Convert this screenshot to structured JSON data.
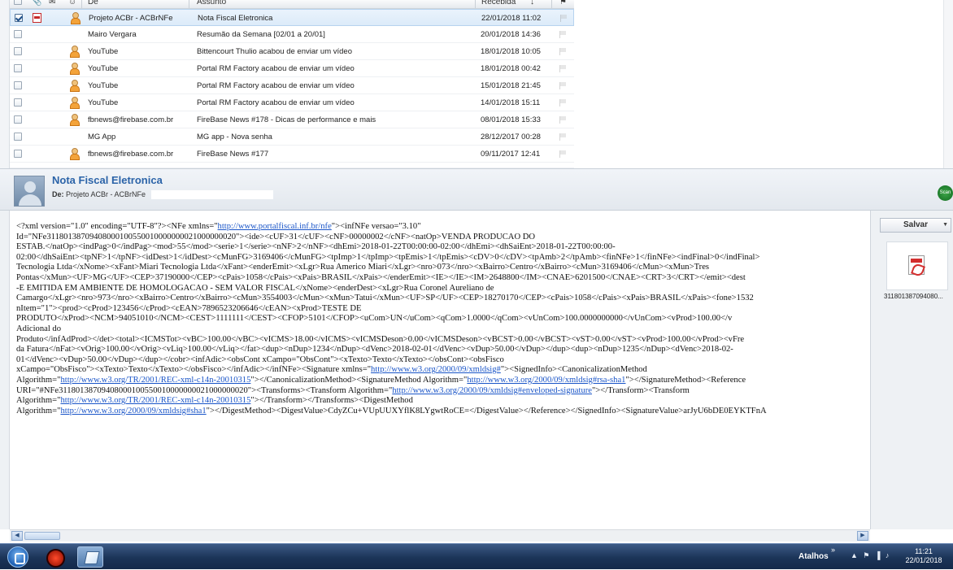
{
  "list": {
    "headers": {
      "de": "De",
      "assunto": "Assunto",
      "recebida": "Recebida"
    },
    "rows": [
      {
        "from": "Projeto ACBr - ACBrNFe",
        "subject": "Nota Fiscal Eletronica",
        "date": "22/01/2018 11:02",
        "selected": true,
        "checked": true,
        "attachment": true,
        "person": true
      },
      {
        "from": "Mairo Vergara",
        "subject": "Resumão da Semana [02/01 a 20/01]",
        "date": "20/01/2018 14:36",
        "selected": false,
        "checked": false,
        "attachment": false,
        "person": false
      },
      {
        "from": "YouTube",
        "subject": "Bittencourt Thulio acabou de enviar um vídeo",
        "date": "18/01/2018 10:05",
        "selected": false,
        "checked": false,
        "attachment": false,
        "person": true
      },
      {
        "from": "YouTube",
        "subject": "Portal RM Factory acabou de enviar um vídeo",
        "date": "18/01/2018 00:42",
        "selected": false,
        "checked": false,
        "attachment": false,
        "person": true
      },
      {
        "from": "YouTube",
        "subject": "Portal RM Factory acabou de enviar um vídeo",
        "date": "15/01/2018 21:45",
        "selected": false,
        "checked": false,
        "attachment": false,
        "person": true
      },
      {
        "from": "YouTube",
        "subject": "Portal RM Factory acabou de enviar um vídeo",
        "date": "14/01/2018 15:11",
        "selected": false,
        "checked": false,
        "attachment": false,
        "person": true
      },
      {
        "from": "fbnews@firebase.com.br",
        "subject": "FireBase News #178 - Dicas de performance e mais",
        "date": "08/01/2018 15:33",
        "selected": false,
        "checked": false,
        "attachment": false,
        "person": true
      },
      {
        "from": "MG App",
        "subject": "MG app - Nova senha",
        "date": "28/12/2017 00:28",
        "selected": false,
        "checked": false,
        "attachment": false,
        "person": false
      },
      {
        "from": "fbnews@firebase.com.br",
        "subject": "FireBase News #177",
        "date": "09/11/2017 12:41",
        "selected": false,
        "checked": false,
        "attachment": false,
        "person": true
      }
    ]
  },
  "reading": {
    "subject": "Nota Fiscal Eletronica",
    "from_label": "De:",
    "from_value": "Projeto ACBr - ACBrNFe",
    "scan_label": "Scan"
  },
  "body": {
    "lines": [
      {
        "pre": "<?xml version=\"1.0\" encoding=\"UTF-8\"?><NFe xmlns=\"",
        "link": "http://www.portalfiscal.inf.br/nfe",
        "post": "\"><infNFe versao=\"3.10\""
      },
      {
        "pre": "Id=\"NFe31180138709408000100550010000000021000000020\"><ide><cUF>31</cUF><cNF>00000002</cNF><natOp>VENDA PRODUCAO DO"
      },
      {
        "pre": "ESTAB.</natOp><indPag>0</indPag><mod>55</mod><serie>1</serie><nNF>2</nNF><dhEmi>2018-01-22T00:00:00-02:00</dhEmi><dhSaiEnt>2018-01-22T00:00:00-"
      },
      {
        "pre": "02:00</dhSaiEnt><tpNF>1</tpNF><idDest>1</idDest><cMunFG>3169406</cMunFG><tpImp>1</tpImp><tpEmis>1</tpEmis><cDV>0</cDV><tpAmb>2</tpAmb><finNFe>1</finNFe><indFinal>0</indFinal>"
      },
      {
        "pre": "Tecnologia Ltda</xNome><xFant>Miari Tecnologia Ltda</xFant><enderEmit><xLgr>Rua Americo Miari</xLgr><nro>073</nro><xBairro>Centro</xBairro><cMun>3169406</cMun><xMun>Tres"
      },
      {
        "pre": "Pontas</xMun><UF>MG</UF><CEP>37190000</CEP><cPais>1058</cPais><xPais>BRASIL</xPais></enderEmit><IE></IE><IM>2648800</IM><CNAE>6201500</CNAE><CRT>3</CRT></emit><dest"
      },
      {
        "pre": "-E EMITIDA EM AMBIENTE DE HOMOLOGACAO - SEM VALOR FISCAL</xNome><enderDest><xLgr>Rua Coronel Aureliano de"
      },
      {
        "pre": "Camargo</xLgr><nro>973</nro><xBairro>Centro</xBairro><cMun>3554003</cMun><xMun>Tatui</xMun><UF>SP</UF><CEP>18270170</CEP><cPais>1058</cPais><xPais>BRASIL</xPais><fone>1532"
      },
      {
        "pre": "nItem=\"1\"><prod><cProd>123456</cProd><cEAN>7896523206646</cEAN><xProd>TESTE DE"
      },
      {
        "pre": "PRODUTO</xProd><NCM>94051010</NCM><CEST>1111111</CEST><CFOP>5101</CFOP><uCom>UN</uCom><qCom>1.0000</qCom><vUnCom>100.0000000000</vUnCom><vProd>100.00</v"
      },
      {
        "pre": "Adicional do"
      },
      {
        "pre": "Produto</infAdProd></det><total><ICMSTot><vBC>100.00</vBC><vICMS>18.00</vICMS><vICMSDeson>0.00</vICMSDeson><vBCST>0.00</vBCST><vST>0.00</vST><vProd>100.00</vProd><vFre"
      },
      {
        "pre": "da Fatura</nFat><vOrig>100.00</vOrig><vLiq>100.00</vLiq></fat><dup><nDup>1234</nDup><dVenc>2018-02-01</dVenc><vDup>50.00</vDup></dup><dup><nDup>1235</nDup><dVenc>2018-02-"
      },
      {
        "pre": "01</dVenc><vDup>50.00</vDup></dup></cobr><infAdic><obsCont xCampo=\"ObsCont\"><xTexto>Texto</xTexto></obsCont><obsFisco"
      },
      {
        "pre": "xCampo=\"ObsFisco\"><xTexto>Texto</xTexto></obsFisco></infAdic></infNFe><Signature xmlns=\"",
        "link": "http://www.w3.org/2000/09/xmldsig#",
        "post": "\"><SignedInfo><CanonicalizationMethod"
      },
      {
        "pre": "Algorithm=\"",
        "link": "http://www.w3.org/TR/2001/REC-xml-c14n-20010315",
        "post": "\"></CanonicalizationMethod><SignatureMethod Algorithm=\"",
        "link2": "http://www.w3.org/2000/09/xmldsig#rsa-sha1",
        "post2": "\"></SignatureMethod><Reference"
      },
      {
        "pre": "URI=\"#NFe31180138709408000100550010000000021000000020\"><Transforms><Transform Algorithm=\"",
        "link": "http://www.w3.org/2000/09/xmldsig#enveloped-signature",
        "post": "\"></Transform><Transform"
      },
      {
        "pre": "Algorithm=\"",
        "link": "http://www.w3.org/TR/2001/REC-xml-c14n-20010315",
        "post": "\"></Transform></Transforms><DigestMethod"
      },
      {
        "pre": "Algorithm=\"",
        "link": "http://www.w3.org/2000/09/xmldsig#sha1",
        "post": "\"></DigestMethod><DigestValue>CdyZCu+VUpUUXYflK8LYgwtRoCE=</DigestValue></Reference></SignedInfo><SignatureValue>arJyU6bDE0EYKTFnA"
      }
    ]
  },
  "attachments": {
    "save_label": "Salvar",
    "file_name": "311801387094080...",
    "file_icon": "pdf-icon"
  },
  "taskbar": {
    "shortcuts_label": "Atalhos",
    "time": "11:21",
    "date": "22/01/2018"
  }
}
